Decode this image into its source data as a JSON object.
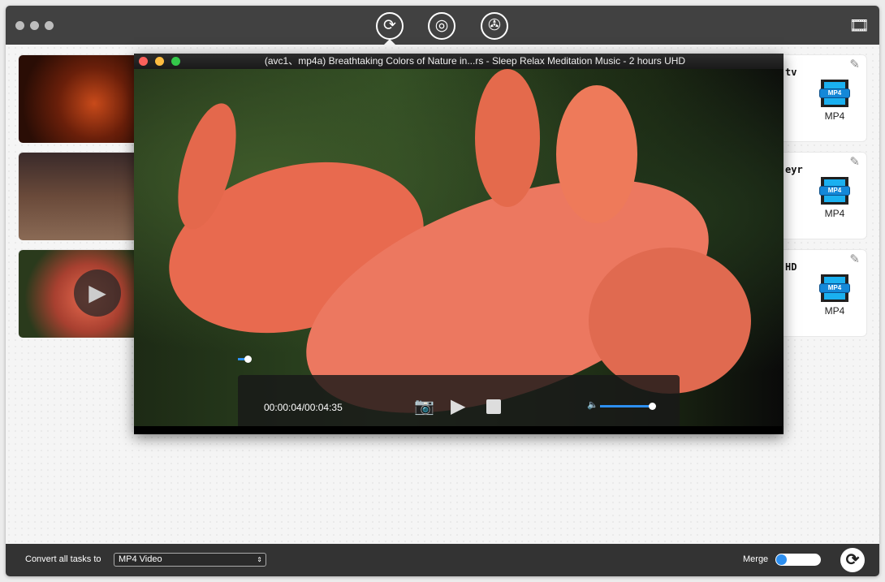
{
  "toolbar": {
    "tabs": [
      {
        "icon": "convert-icon",
        "active": true
      },
      {
        "icon": "rip-icon"
      },
      {
        "icon": "download-icon"
      }
    ],
    "right_icon": "media-library-icon"
  },
  "tasks": [
    {
      "title_fragment": "tv",
      "format": "MP4",
      "format_icon": "mp4-file-icon"
    },
    {
      "title_fragment": "eyr",
      "format": "MP4",
      "format_icon": "mp4-file-icon"
    },
    {
      "title_fragment": "HD",
      "format": "MP4",
      "format_icon": "mp4-file-icon"
    }
  ],
  "player": {
    "title": "(avc1、mp4a)  Breathtaking Colors of Nature in...rs - Sleep Relax Meditation Music - 2 hours UHD",
    "time": "00:00:04/00:04:35",
    "progress_fraction": 0.015,
    "volume_fraction": 1.0
  },
  "bottom": {
    "convert_label": "Convert all tasks to",
    "format_value": "MP4 Video",
    "merge_label": "Merge",
    "merge_on": false
  },
  "colors": {
    "accent": "#2d8ff0",
    "titlebar": "#414141",
    "bottombar": "#333333"
  }
}
